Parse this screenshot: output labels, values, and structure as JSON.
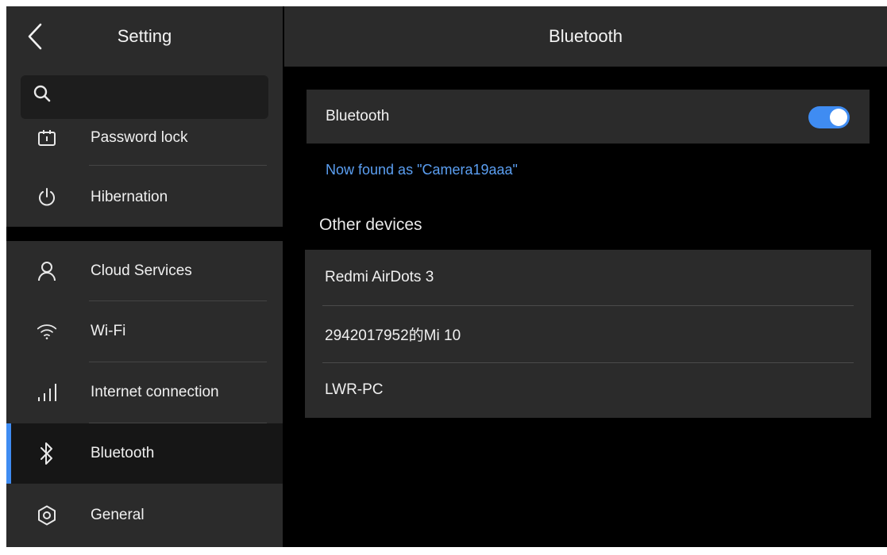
{
  "sidebar": {
    "title": "Setting",
    "search": {
      "placeholder": ""
    },
    "items": [
      {
        "label": "Password lock",
        "icon": "password-lock-icon"
      },
      {
        "label": "Hibernation",
        "icon": "power-icon"
      },
      {
        "label": "Cloud Services",
        "icon": "user-icon"
      },
      {
        "label": "Wi-Fi",
        "icon": "wifi-icon"
      },
      {
        "label": "Internet connection",
        "icon": "signal-icon"
      },
      {
        "label": "Bluetooth",
        "icon": "bluetooth-icon",
        "active": true
      },
      {
        "label": "General",
        "icon": "gear-icon"
      }
    ]
  },
  "main": {
    "title": "Bluetooth",
    "toggle_row": {
      "label": "Bluetooth",
      "enabled": true
    },
    "found_as": "Now found as \"Camera19aaa\"",
    "other_devices_title": "Other devices",
    "devices": [
      "Redmi AirDots 3",
      "2942017952的Mi 10",
      "LWR-PC"
    ]
  },
  "colors": {
    "accent": "#3f8cf2",
    "panel": "#2b2b2b",
    "background": "#000000",
    "link": "#5b9ff2"
  }
}
